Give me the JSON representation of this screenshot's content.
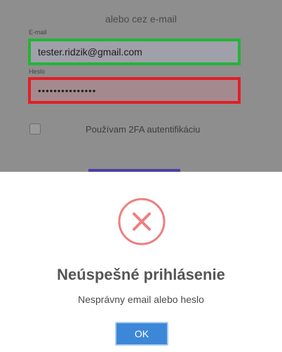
{
  "login_form": {
    "divider_text": "alebo cez e-mail",
    "email_label": "E-mail",
    "email_value": "tester.ridzik@gmail.com",
    "password_label": "Heslo",
    "password_value": "•••••••••••••••",
    "twofa_label": "Používam 2FA autentifikáciu",
    "twofa_checked": false
  },
  "modal": {
    "icon": "error-x-icon",
    "title": "Neúspešné prihlásenie",
    "message": "Nesprávny email alebo heslo",
    "ok_label": "OK"
  },
  "colors": {
    "email_highlight": "#22b53a",
    "password_highlight": "#e31f26",
    "error_icon": "#ef7e7e",
    "ok_button": "#3d87d8"
  }
}
